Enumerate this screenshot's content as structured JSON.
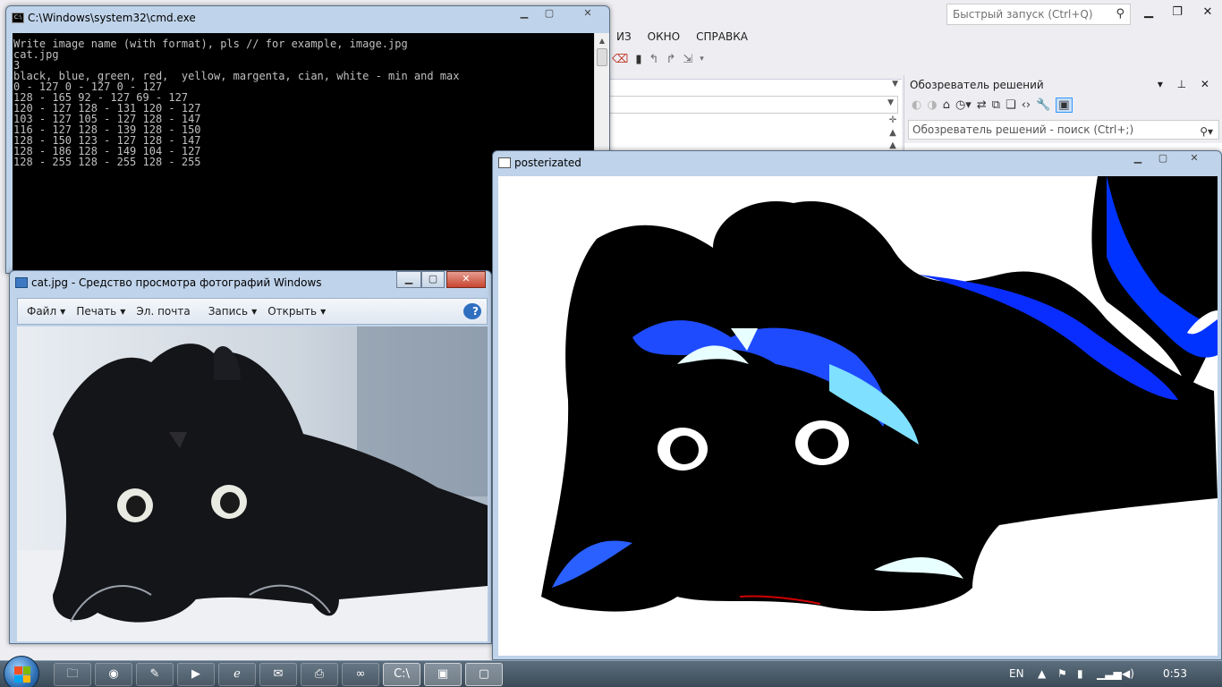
{
  "visual_studio": {
    "quick_launch_placeholder": "Быстрый запуск (Ctrl+Q)",
    "menu": [
      "ИЗ",
      "ОКНО",
      "СПРАВКА"
    ],
    "solution_explorer": {
      "title": "Обозреватель решений",
      "search_placeholder": "Обозреватель решений - поиск (Ctrl+;)"
    }
  },
  "cmd_window": {
    "title": "C:\\Windows\\system32\\cmd.exe",
    "lines": [
      "Write image name (with format), pls // for example, image.jpg",
      "cat.jpg",
      "3",
      "black, blue, green, red,  yellow, margenta, cian, white - min and max",
      "0 - 127 0 - 127 0 - 127",
      "128 - 165 92 - 127 69 - 127",
      "120 - 127 128 - 131 120 - 127",
      "103 - 127 105 - 127 128 - 147",
      "116 - 127 128 - 139 128 - 150",
      "128 - 150 123 - 127 128 - 147",
      "128 - 186 128 - 149 104 - 127",
      "128 - 255 128 - 255 128 - 255"
    ]
  },
  "photo_viewer": {
    "title": "cat.jpg - Средство просмотра фотографий Windows",
    "menu": {
      "file": "Файл",
      "print": "Печать",
      "email": "Эл. почта",
      "burn": "Запись",
      "open": "Открыть",
      "help": "?"
    }
  },
  "posterized_window": {
    "title": "posterizated"
  },
  "taskbar": {
    "language": "EN",
    "clock": "0:53",
    "apps": [
      "explorer-icon",
      "chrome-icon",
      "notepad-icon",
      "media-player-icon",
      "ie-icon",
      "outlook-icon",
      "scanner-icon",
      "visual-studio-icon",
      "cmd-icon",
      "photo-viewer-icon",
      "opencv-window-icon"
    ]
  }
}
